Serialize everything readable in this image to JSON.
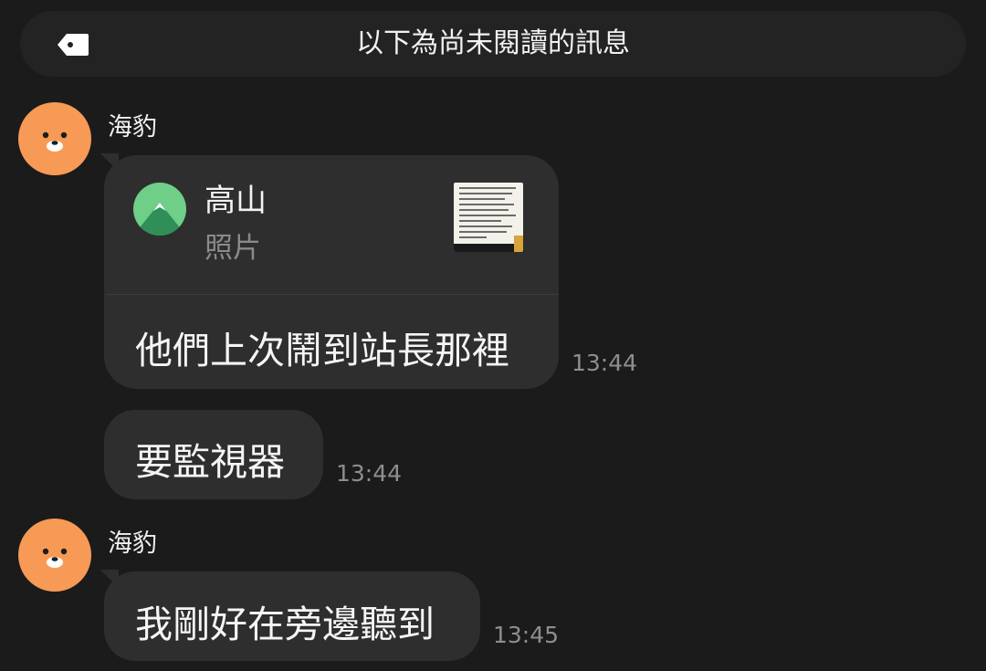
{
  "banner": {
    "text": "以下為尚未閱讀的訊息",
    "icon": "tag-icon"
  },
  "messages": [
    {
      "sender": "海豹",
      "reply": {
        "name": "高山",
        "type": "照片"
      },
      "text": "他們上次鬧到站長那裡",
      "time": "13:44"
    },
    {
      "text": "要監視器",
      "time": "13:44"
    },
    {
      "sender": "海豹",
      "text": "我剛好在旁邊聽到",
      "time": "13:45"
    }
  ],
  "colors": {
    "background": "#1b1b1b",
    "bubble": "#2e2e2e",
    "avatar_orange": "#f79a55",
    "reply_avatar_green": "#6fcf88",
    "timestamp": "#8e8e8e"
  }
}
